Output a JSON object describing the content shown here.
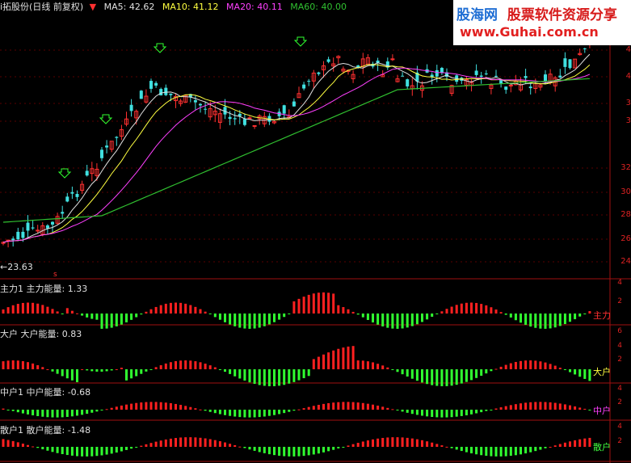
{
  "header": {
    "title": "i拓股份(日线 前复权)",
    "ma5": "MA5: 42.62",
    "ma10": "MA10: 41.12",
    "ma20": "MA20: 40.11",
    "ma60": "MA60: 40.00"
  },
  "logo": {
    "name": "股海网",
    "slogan": "股票软件资源分享",
    "url": "www.Guhai.com.cn"
  },
  "price_axis": [
    "4",
    "4",
    "3",
    "3",
    "32",
    "30",
    "28",
    "26",
    "24"
  ],
  "low_marker": "←23.63",
  "panels": [
    {
      "left_label": "主力1 主力能量: 1.33",
      "right_label": "主力",
      "color": "#ff3030"
    },
    {
      "left_label": "大户 大户能量: 0.83",
      "right_label": "大户",
      "color": "#ffff40"
    },
    {
      "left_label": "中户1 中户能量: -0.68",
      "right_label": "中户",
      "color": "#ff40ff"
    },
    {
      "left_label": "散户1 散户能量: -1.48",
      "right_label": "散户",
      "color": "#40ff40"
    }
  ],
  "panel_axis": [
    [
      "4",
      "2"
    ],
    [
      "6",
      "4",
      "2"
    ],
    [
      "4",
      "2"
    ],
    [
      "4",
      "2"
    ]
  ],
  "colors": {
    "up": "#ff3030",
    "down": "#40e0e0",
    "ma5": "#e0e0e0",
    "ma10": "#ffff40",
    "ma20": "#ff40ff",
    "ma60": "#30c030",
    "neg_bar": "#30ff30",
    "pos_bar": "#ff2020"
  }
}
